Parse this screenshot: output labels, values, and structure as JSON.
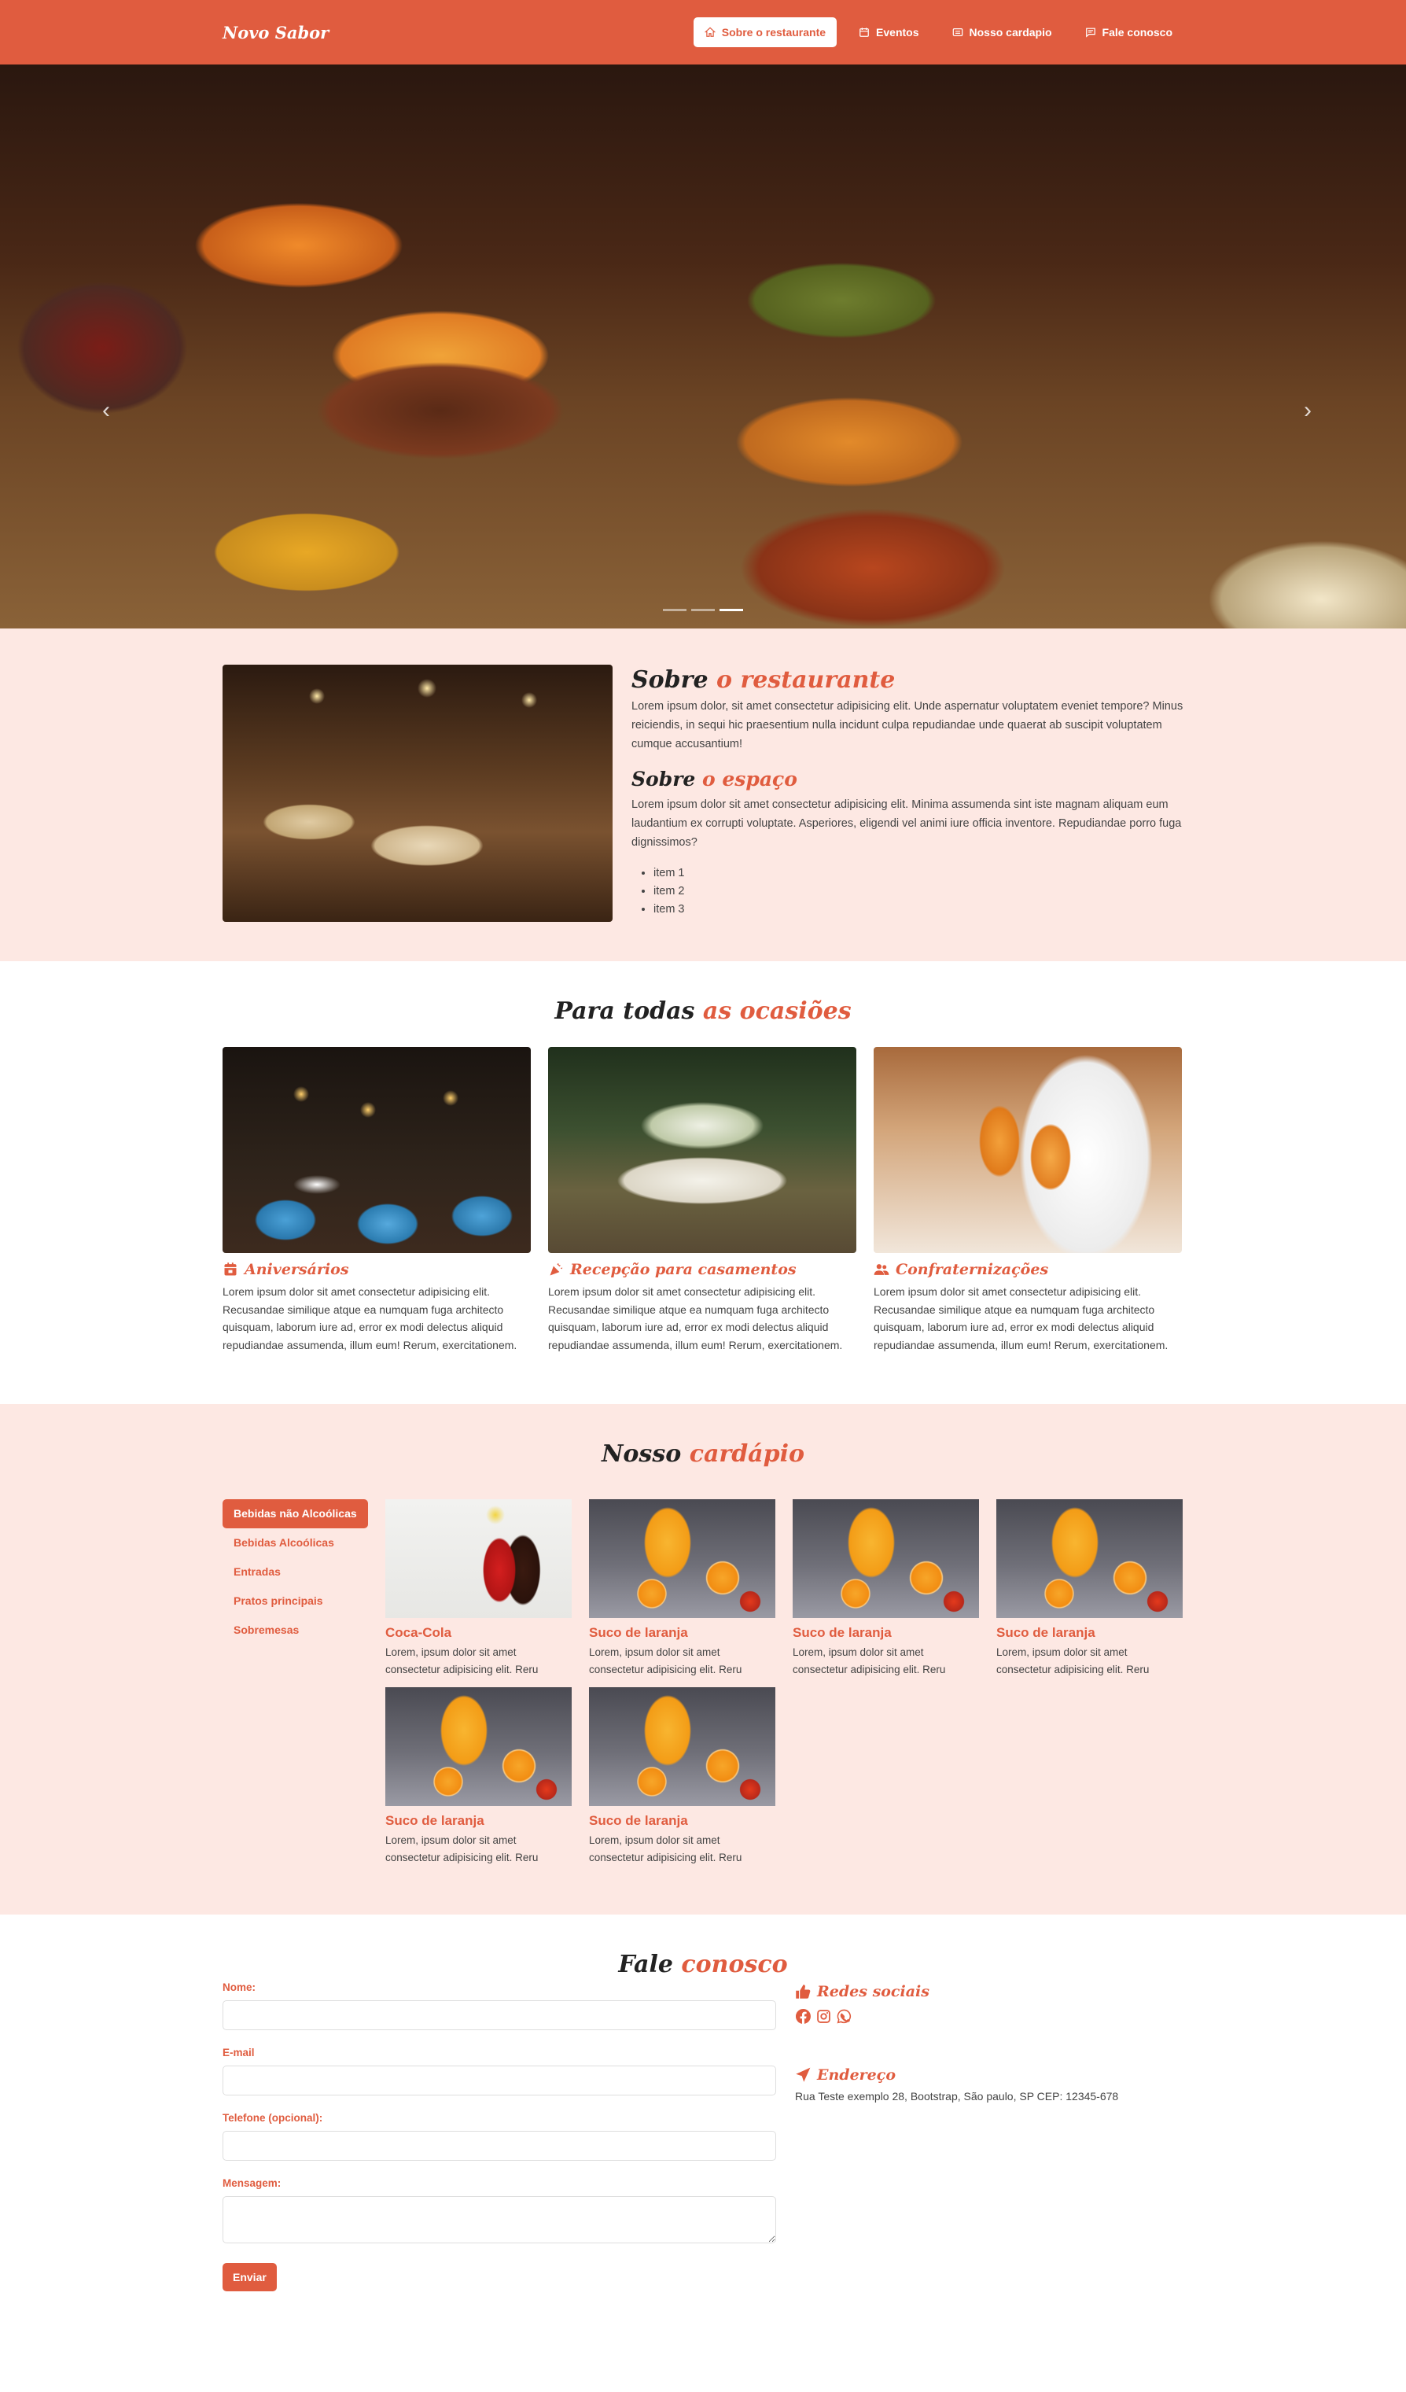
{
  "brand": "Novo Sabor",
  "nav": [
    {
      "label": "Sobre o restaurante"
    },
    {
      "label": "Eventos"
    },
    {
      "label": "Nosso cardapio"
    },
    {
      "label": "Fale conosco"
    }
  ],
  "hero": {
    "slides": 3,
    "active_slide": 3
  },
  "about": {
    "title_a": "Sobre",
    "title_b": "o restaurante",
    "p1": "Lorem ipsum dolor, sit amet consectetur adipisicing elit. Unde aspernatur voluptatem eveniet tempore? Minus reiciendis, in sequi hic praesentium nulla incidunt culpa repudiandae unde quaerat ab suscipit voluptatem cumque accusantium!",
    "sub_a": "Sobre",
    "sub_b": "o espaço",
    "p2": "Lorem ipsum dolor sit amet consectetur adipisicing elit. Minima assumenda sint iste magnam aliquam eum laudantium ex corrupti voluptate. Asperiores, eligendi vel animi iure officia inventore. Repudiandae porro fuga dignissimos?",
    "items": [
      "item 1",
      "item 2",
      "item 3"
    ]
  },
  "occasions": {
    "title_a": "Para todas",
    "title_b": "as ocasiões",
    "cards": [
      {
        "title": "Aniversários",
        "icon": "calendar-icon",
        "text": "Lorem ipsum dolor sit amet consectetur adipisicing elit. Recusandae similique atque ea numquam fuga architecto quisquam, laborum iure ad, error ex modi delectus aliquid repudiandae assumenda, illum eum! Rerum, exercitationem."
      },
      {
        "title": "Recepção para casamentos",
        "icon": "party-icon",
        "text": "Lorem ipsum dolor sit amet consectetur adipisicing elit. Recusandae similique atque ea numquam fuga architecto quisquam, laborum iure ad, error ex modi delectus aliquid repudiandae assumenda, illum eum! Rerum, exercitationem."
      },
      {
        "title": "Confraternizações",
        "icon": "people-icon",
        "text": "Lorem ipsum dolor sit amet consectetur adipisicing elit. Recusandae similique atque ea numquam fuga architecto quisquam, laborum iure ad, error ex modi delectus aliquid repudiandae assumenda, illum eum! Rerum, exercitationem."
      }
    ]
  },
  "menu": {
    "title_a": "Nosso",
    "title_b": "cardápio",
    "tabs": [
      "Bebidas não Alcoólicas",
      "Bebidas Alcoólicas",
      "Entradas",
      "Pratos principais",
      "Sobremesas"
    ],
    "products": [
      {
        "name": "Coca-Cola",
        "desc": "Lorem, ipsum dolor sit amet consectetur adipisicing elit. Reru"
      },
      {
        "name": "Suco de laranja",
        "desc": "Lorem, ipsum dolor sit amet consectetur adipisicing elit. Reru"
      },
      {
        "name": "Suco de laranja",
        "desc": "Lorem, ipsum dolor sit amet consectetur adipisicing elit. Reru"
      },
      {
        "name": "Suco de laranja",
        "desc": "Lorem, ipsum dolor sit amet consectetur adipisicing elit. Reru"
      },
      {
        "name": "Suco de laranja",
        "desc": "Lorem, ipsum dolor sit amet consectetur adipisicing elit. Reru"
      },
      {
        "name": "Suco de laranja",
        "desc": "Lorem, ipsum dolor sit amet consectetur adipisicing elit. Reru"
      }
    ]
  },
  "contact": {
    "title_a": "Fale",
    "title_b": "conosco",
    "name_label": "Nome:",
    "email_label": "E-mail",
    "phone_label": "Telefone (opcional):",
    "message_label": "Mensagem:",
    "submit": "Enviar",
    "social_title": "Redes sociais",
    "address_title": "Endereço",
    "address": "Rua Teste exemplo 28, Bootstrap, São paulo, SP CEP: 12345-678"
  },
  "colors": {
    "accent": "#e05c3f",
    "section_bg": "#fde8e3"
  }
}
